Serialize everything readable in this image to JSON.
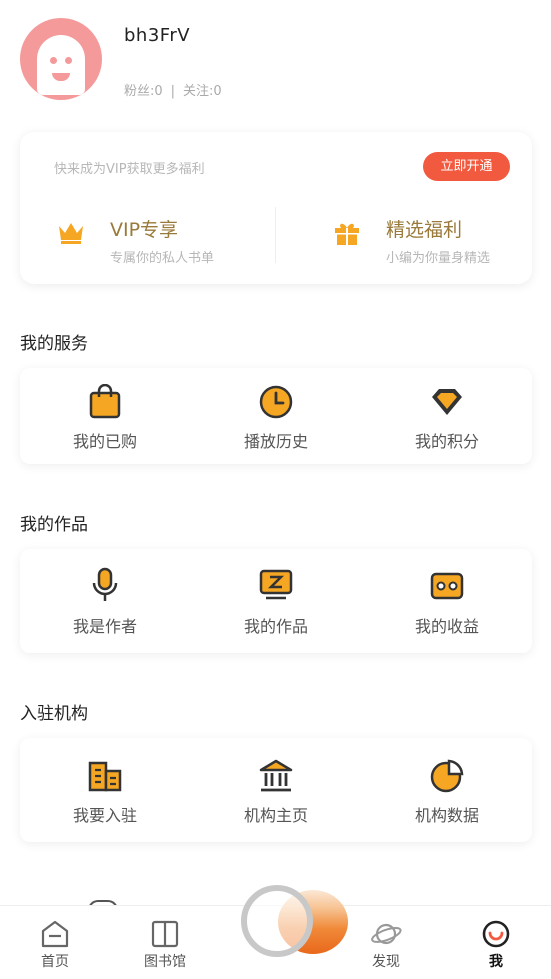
{
  "profile": {
    "username": "bh3FrV",
    "fans_label": "粉丝:0",
    "separator": "|",
    "follow_label": "关注:0"
  },
  "vip": {
    "tip": "快来成为VIP获取更多福利",
    "open_button": "立即开通",
    "items": [
      {
        "title": "VIP专享",
        "subtitle": "专属你的私人书单",
        "icon": "crown-icon"
      },
      {
        "title": "精选福利",
        "subtitle": "小编为你量身精选",
        "icon": "gift-icon"
      }
    ]
  },
  "sections": {
    "services": {
      "title": "我的服务",
      "items": [
        {
          "label": "我的已购",
          "icon": "shopping-bag-icon"
        },
        {
          "label": "播放历史",
          "icon": "clock-icon"
        },
        {
          "label": "我的积分",
          "icon": "diamond-icon"
        }
      ]
    },
    "works": {
      "title": "我的作品",
      "items": [
        {
          "label": "我是作者",
          "icon": "microphone-icon"
        },
        {
          "label": "我的作品",
          "icon": "works-monitor-icon"
        },
        {
          "label": "我的收益",
          "icon": "earnings-icon"
        }
      ]
    },
    "institution": {
      "title": "入驻机构",
      "items": [
        {
          "label": "我要入驻",
          "icon": "building-icon"
        },
        {
          "label": "机构主页",
          "icon": "institution-icon"
        },
        {
          "label": "机构数据",
          "icon": "pie-chart-icon"
        }
      ]
    }
  },
  "tabbar": {
    "items": [
      {
        "label": "首页",
        "icon": "home-icon"
      },
      {
        "label": "图书馆",
        "icon": "library-icon"
      },
      {
        "label": "发现",
        "icon": "planet-icon"
      },
      {
        "label": "我",
        "icon": "me-icon"
      }
    ],
    "active": "我"
  },
  "colors": {
    "accent": "#f5a623",
    "vip_button": "#f25a3f",
    "vip_text": "#9a7a3a",
    "avatar": "#f49a9a"
  }
}
